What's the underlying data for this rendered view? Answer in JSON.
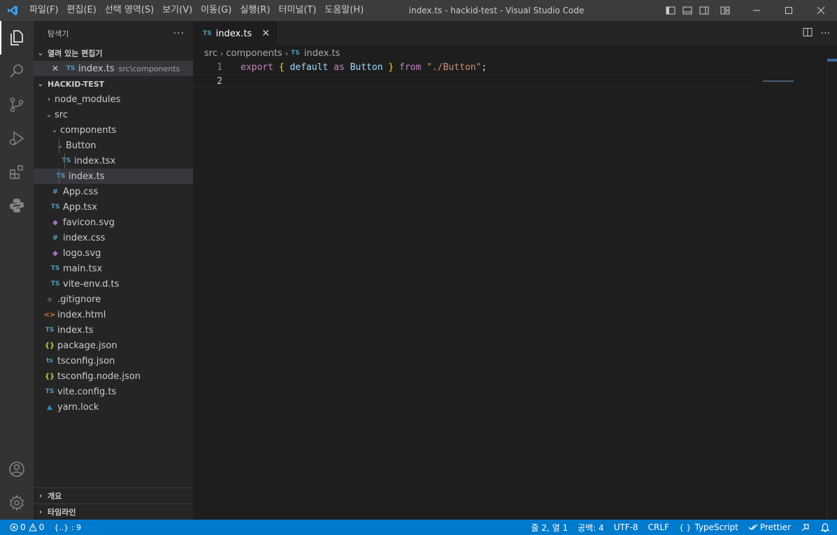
{
  "window": {
    "title": "index.ts - hackid-test - Visual Studio Code",
    "menu": [
      "파일(F)",
      "편집(E)",
      "선택 영역(S)",
      "보기(V)",
      "이동(G)",
      "실행(R)",
      "터미널(T)",
      "도움말(H)"
    ]
  },
  "activity_bar": [
    "explorer-icon",
    "search-icon",
    "source-control-icon",
    "run-debug-icon",
    "extensions-icon",
    "python-icon",
    "account-icon",
    "settings-gear-icon"
  ],
  "sidebar": {
    "title": "탐색기",
    "more": "···",
    "open_editors": {
      "label": "열려 있는 편집기",
      "items": [
        {
          "close": "✕",
          "icon": "TS",
          "name": "index.ts",
          "path": "src\\components"
        }
      ]
    },
    "project": {
      "label": "HACKID-TEST",
      "tree": [
        {
          "name": "node_modules",
          "icon": "",
          "chevron": "›",
          "color": ""
        },
        {
          "name": "src",
          "icon": "",
          "chevron": "⌄",
          "color": ""
        },
        {
          "name": "components",
          "icon": "",
          "chevron": "⌄",
          "color": ""
        },
        {
          "name": "Button",
          "icon": "",
          "chevron": "⌄",
          "color": ""
        },
        {
          "name": "index.tsx",
          "icon": "TS",
          "chevron": "",
          "color": "#519aba"
        },
        {
          "name": "index.ts",
          "icon": "TS",
          "chevron": "",
          "color": "#519aba"
        },
        {
          "name": "App.css",
          "icon": "#",
          "chevron": "",
          "color": "#519aba"
        },
        {
          "name": "App.tsx",
          "icon": "TS",
          "chevron": "",
          "color": "#519aba"
        },
        {
          "name": "favicon.svg",
          "icon": "◆",
          "chevron": "",
          "color": "#a074c4"
        },
        {
          "name": "index.css",
          "icon": "#",
          "chevron": "",
          "color": "#519aba"
        },
        {
          "name": "logo.svg",
          "icon": "◆",
          "chevron": "",
          "color": "#a074c4"
        },
        {
          "name": "main.tsx",
          "icon": "TS",
          "chevron": "",
          "color": "#519aba"
        },
        {
          "name": "vite-env.d.ts",
          "icon": "TS",
          "chevron": "",
          "color": "#519aba"
        },
        {
          "name": ".gitignore",
          "icon": "◆",
          "chevron": "",
          "color": "#41535b"
        },
        {
          "name": "index.html",
          "icon": "<>",
          "chevron": "",
          "color": "#e37933"
        },
        {
          "name": "index.ts",
          "icon": "TS",
          "chevron": "",
          "color": "#519aba"
        },
        {
          "name": "package.json",
          "icon": "{}",
          "chevron": "",
          "color": "#cbcb41"
        },
        {
          "name": "tsconfig.json",
          "icon": "ts",
          "chevron": "",
          "color": "#519aba"
        },
        {
          "name": "tsconfig.node.json",
          "icon": "{}",
          "chevron": "",
          "color": "#cbcb41"
        },
        {
          "name": "vite.config.ts",
          "icon": "TS",
          "chevron": "",
          "color": "#519aba"
        },
        {
          "name": "yarn.lock",
          "icon": "▲",
          "chevron": "",
          "color": "#2c8ebb"
        }
      ]
    },
    "outline_label": "개요",
    "timeline_label": "타임라인"
  },
  "editor": {
    "tab": {
      "icon": "TS",
      "label": "index.ts",
      "close": "✕"
    },
    "breadcrumb": [
      "src",
      "components",
      "index.ts"
    ],
    "breadcrumb_icon": "TS",
    "lines": [
      {
        "number": "1",
        "tokens": [
          {
            "t": "export ",
            "c": "kw"
          },
          {
            "t": "{ ",
            "c": "br"
          },
          {
            "t": "default ",
            "c": "var"
          },
          {
            "t": "as ",
            "c": "kw"
          },
          {
            "t": "Button ",
            "c": "var"
          },
          {
            "t": "} ",
            "c": "br"
          },
          {
            "t": "from ",
            "c": "kw"
          },
          {
            "t": "\"./Button\"",
            "c": "str"
          },
          {
            "t": ";",
            "c": "plain"
          }
        ]
      },
      {
        "number": "2",
        "tokens": []
      }
    ]
  },
  "status_bar": {
    "errors": "0",
    "warnings": "0",
    "brackets": "{..} : 9",
    "position": "줄 2, 열 1",
    "spaces": "공백: 4",
    "encoding": "UTF-8",
    "eol": "CRLF",
    "language_icon": "{ }",
    "language": "TypeScript",
    "formatter": "Prettier"
  },
  "colors": {
    "accent": "#007acc",
    "ts_icon": "#519aba"
  }
}
